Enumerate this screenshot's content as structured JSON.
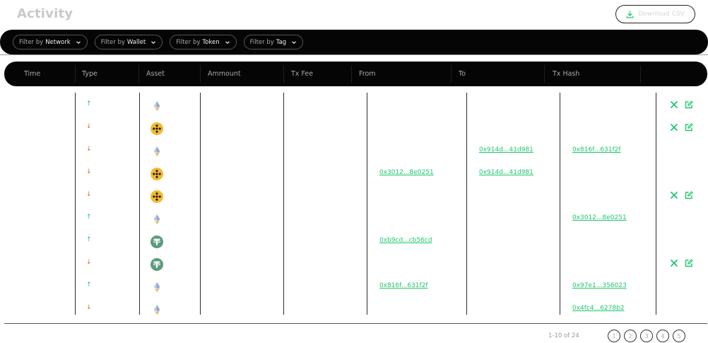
{
  "page": {
    "title": "Activity"
  },
  "toolbar": {
    "download_label": "Download CSV"
  },
  "filters": [
    {
      "prefix": "Filter by",
      "value": "Network"
    },
    {
      "prefix": "Filter by",
      "value": "Wallet"
    },
    {
      "prefix": "Filter by",
      "value": "Token"
    },
    {
      "prefix": "Filter by",
      "value": "Tag"
    }
  ],
  "table": {
    "columns": [
      "Time",
      "Type",
      "Asset",
      "Ammount",
      "Tx Fee",
      "From",
      "To",
      "Tx Hash"
    ],
    "rows": [
      {
        "type": "up",
        "asset": "eth-icon",
        "from": "",
        "to": "",
        "hash": "",
        "actions": true
      },
      {
        "type": "down",
        "asset": "bnb-icon",
        "from": "",
        "to": "",
        "hash": "",
        "actions": true
      },
      {
        "type": "down",
        "asset": "eth-icon",
        "from": "",
        "to": "0x914d...41d981",
        "hash": "0x816f...631f2f",
        "actions": false
      },
      {
        "type": "down",
        "asset": "bnb-icon",
        "from": "0x3012...8e0251",
        "to": "0x914d...41d981",
        "hash": "",
        "actions": false
      },
      {
        "type": "down",
        "asset": "bnb-icon",
        "from": "",
        "to": "",
        "hash": "",
        "actions": true
      },
      {
        "type": "up",
        "asset": "eth-icon",
        "from": "",
        "to": "",
        "hash": "0x3012...8e0251",
        "actions": false
      },
      {
        "type": "up",
        "asset": "tether-icon",
        "from": "0xb9cd...cb56cd",
        "to": "",
        "hash": "",
        "actions": false
      },
      {
        "type": "down",
        "asset": "tether-icon",
        "from": "",
        "to": "",
        "hash": "",
        "actions": true
      },
      {
        "type": "up",
        "asset": "eth-icon",
        "from": "0x816f...631f2f",
        "to": "",
        "hash": "0x97e1...356023",
        "actions": false
      },
      {
        "type": "down",
        "asset": "eth-icon",
        "from": "",
        "to": "",
        "hash": "0x4fc4...6278b2",
        "actions": false
      }
    ]
  },
  "arrows": {
    "up": "↑",
    "down": "↓"
  },
  "pagination": {
    "range": "1-10 of 24",
    "pages": [
      "1",
      "2",
      "3",
      "4",
      "5"
    ]
  },
  "colors": {
    "accent": "#1fc86c",
    "up": "#22c66b",
    "down": "#f05a3a",
    "bnb": "#f3ba2f",
    "tether": "#5b9b7c",
    "bar": "#050505"
  }
}
